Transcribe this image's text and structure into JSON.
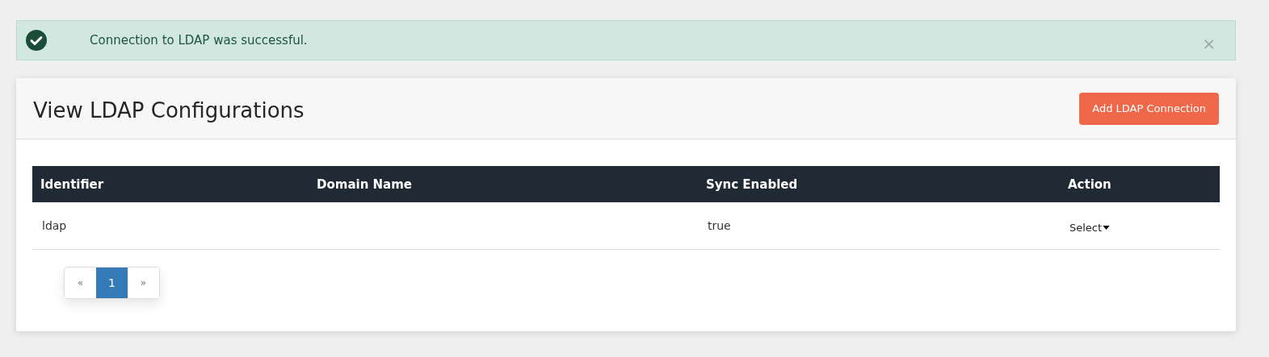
{
  "alert": {
    "message": "Connection to LDAP was successful.",
    "close": "×"
  },
  "card": {
    "title": "View LDAP Configurations",
    "add_button": "Add LDAP Connection"
  },
  "table": {
    "columns": [
      "Identifier",
      "Domain Name",
      "Sync Enabled",
      "Action"
    ],
    "rows": [
      {
        "identifier": "ldap",
        "domain_name": "",
        "sync_enabled": "true",
        "action": "Select"
      }
    ]
  },
  "pagination": {
    "prev": "«",
    "next": "»",
    "pages": [
      {
        "label": "1",
        "selected": true
      }
    ]
  }
}
